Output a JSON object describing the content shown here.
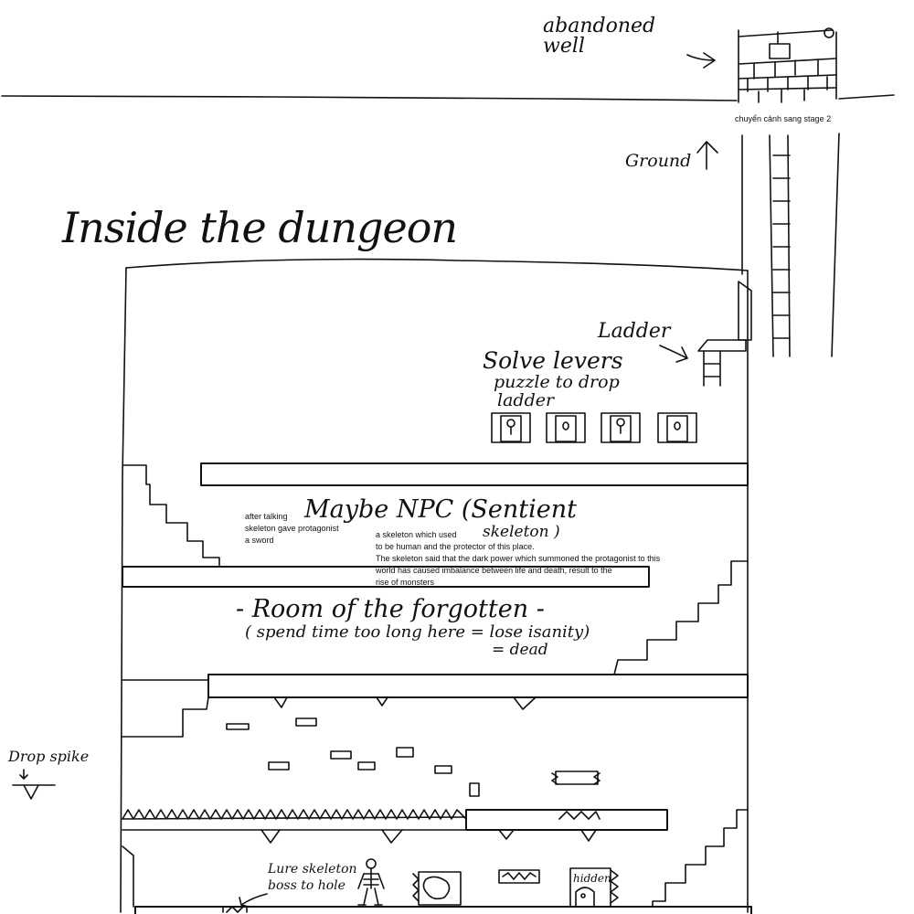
{
  "surface": {
    "well_label_line1": "abandoned",
    "well_label_line2": "well",
    "stage_transition_note": "chuyển cảnh sang stage 2",
    "ground_label": "Ground"
  },
  "dungeon": {
    "title": "Inside the dungeon",
    "ladder_label": "Ladder",
    "puzzle_line1": "Solve levers",
    "puzzle_line2": "puzzle to drop",
    "puzzle_line3": "ladder",
    "npc_title_line1": "Maybe NPC (Sentient",
    "npc_title_line2": "skeleton )",
    "npc_note_line1": "after talking",
    "npc_note_line2": "skeleton gave protagonist",
    "npc_note_line3": "a sword",
    "skeleton_lore_line1": "a skeleton which used",
    "skeleton_lore_line2": "to be human and the protector of this place.",
    "skeleton_lore_line3": "The skeleton said that the dark power which summoned the protagonist to this",
    "skeleton_lore_line4": "world has caused imbalance between life and death, result to the",
    "skeleton_lore_line5": "rise of monsters",
    "room_title": "- Room of the forgotten -",
    "room_warning_line1": "( spend time too long here = lose isanity)",
    "room_warning_line2": "= dead",
    "drop_spike_label": "Drop spike",
    "boss_note_line1": "Lure skeleton",
    "boss_note_line2": "boss to hole",
    "hidden_label": "hidden"
  }
}
